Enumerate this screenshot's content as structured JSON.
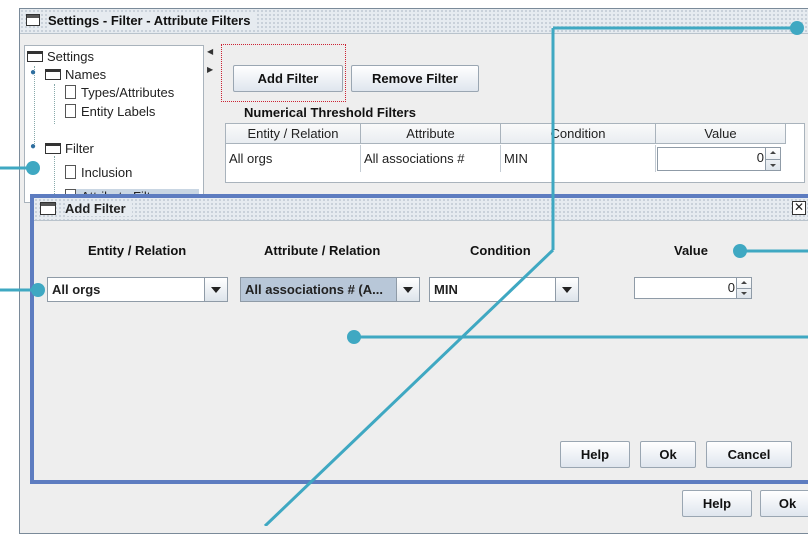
{
  "window": {
    "title": "Settings - Filter - Attribute Filters"
  },
  "tree": {
    "root": "Settings",
    "items": [
      {
        "label": "Names"
      },
      {
        "label": "Types/Attributes"
      },
      {
        "label": "Entity Labels"
      },
      {
        "label": "Filter"
      },
      {
        "label": "Inclusion"
      },
      {
        "label": "Attribute Filters"
      }
    ]
  },
  "toolbar": {
    "add_filter": "Add Filter",
    "remove_filter": "Remove Filter"
  },
  "thresholds": {
    "title": "Numerical Threshold Filters",
    "columns": [
      "Entity / Relation",
      "Attribute",
      "Condition",
      "Value"
    ],
    "rows": [
      {
        "entity": "All orgs",
        "attribute": "All associations #",
        "condition": "MIN",
        "value": "0"
      }
    ]
  },
  "dialog": {
    "title": "Add Filter",
    "labels": {
      "entity": "Entity / Relation",
      "attribute": "Attribute / Relation",
      "condition": "Condition",
      "value": "Value"
    },
    "entity_value": "All orgs",
    "attribute_value": "All associations # (A...",
    "condition_value": "MIN",
    "value": "0",
    "buttons": {
      "help": "Help",
      "ok": "Ok",
      "cancel": "Cancel"
    }
  },
  "footer": {
    "help": "Help",
    "ok": "Ok"
  },
  "colors": {
    "callout": "#3fa8c2",
    "dialog_border": "#5d7cc0",
    "focus": "#cc2233"
  }
}
